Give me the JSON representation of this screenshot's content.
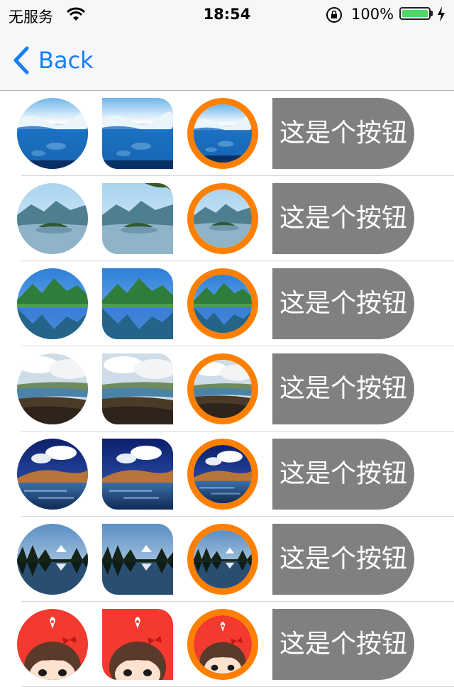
{
  "status_bar": {
    "carrier": "无服务",
    "time": "18:54",
    "battery_percent": "100%",
    "battery_level": 1.0,
    "icons": [
      "wifi-icon",
      "rotation-lock-icon",
      "battery-icon",
      "charging-bolt-icon"
    ]
  },
  "nav": {
    "back_label": "Back",
    "back_icon": "chevron-left-icon",
    "tint": "#157efb"
  },
  "rows": [
    {
      "image": "ocean-wave-dolphins",
      "button_label": "这是个按钮"
    },
    {
      "image": "mountain-lake-island",
      "button_label": "这是个按钮"
    },
    {
      "image": "green-mountain-reflection",
      "button_label": "这是个按钮"
    },
    {
      "image": "cloudy-valley-lake",
      "button_label": "这是个按钮"
    },
    {
      "image": "desert-hills-lake",
      "button_label": "这是个按钮"
    },
    {
      "image": "forest-lake-reflection",
      "button_label": "这是个按钮"
    },
    {
      "image": "cartoon-girl-red",
      "button_label": "这是个按钮"
    }
  ],
  "colors": {
    "ring": "#ff7f00",
    "button_bg": "#808080",
    "button_text": "#ffffff",
    "separator": "#d6d6d6"
  }
}
